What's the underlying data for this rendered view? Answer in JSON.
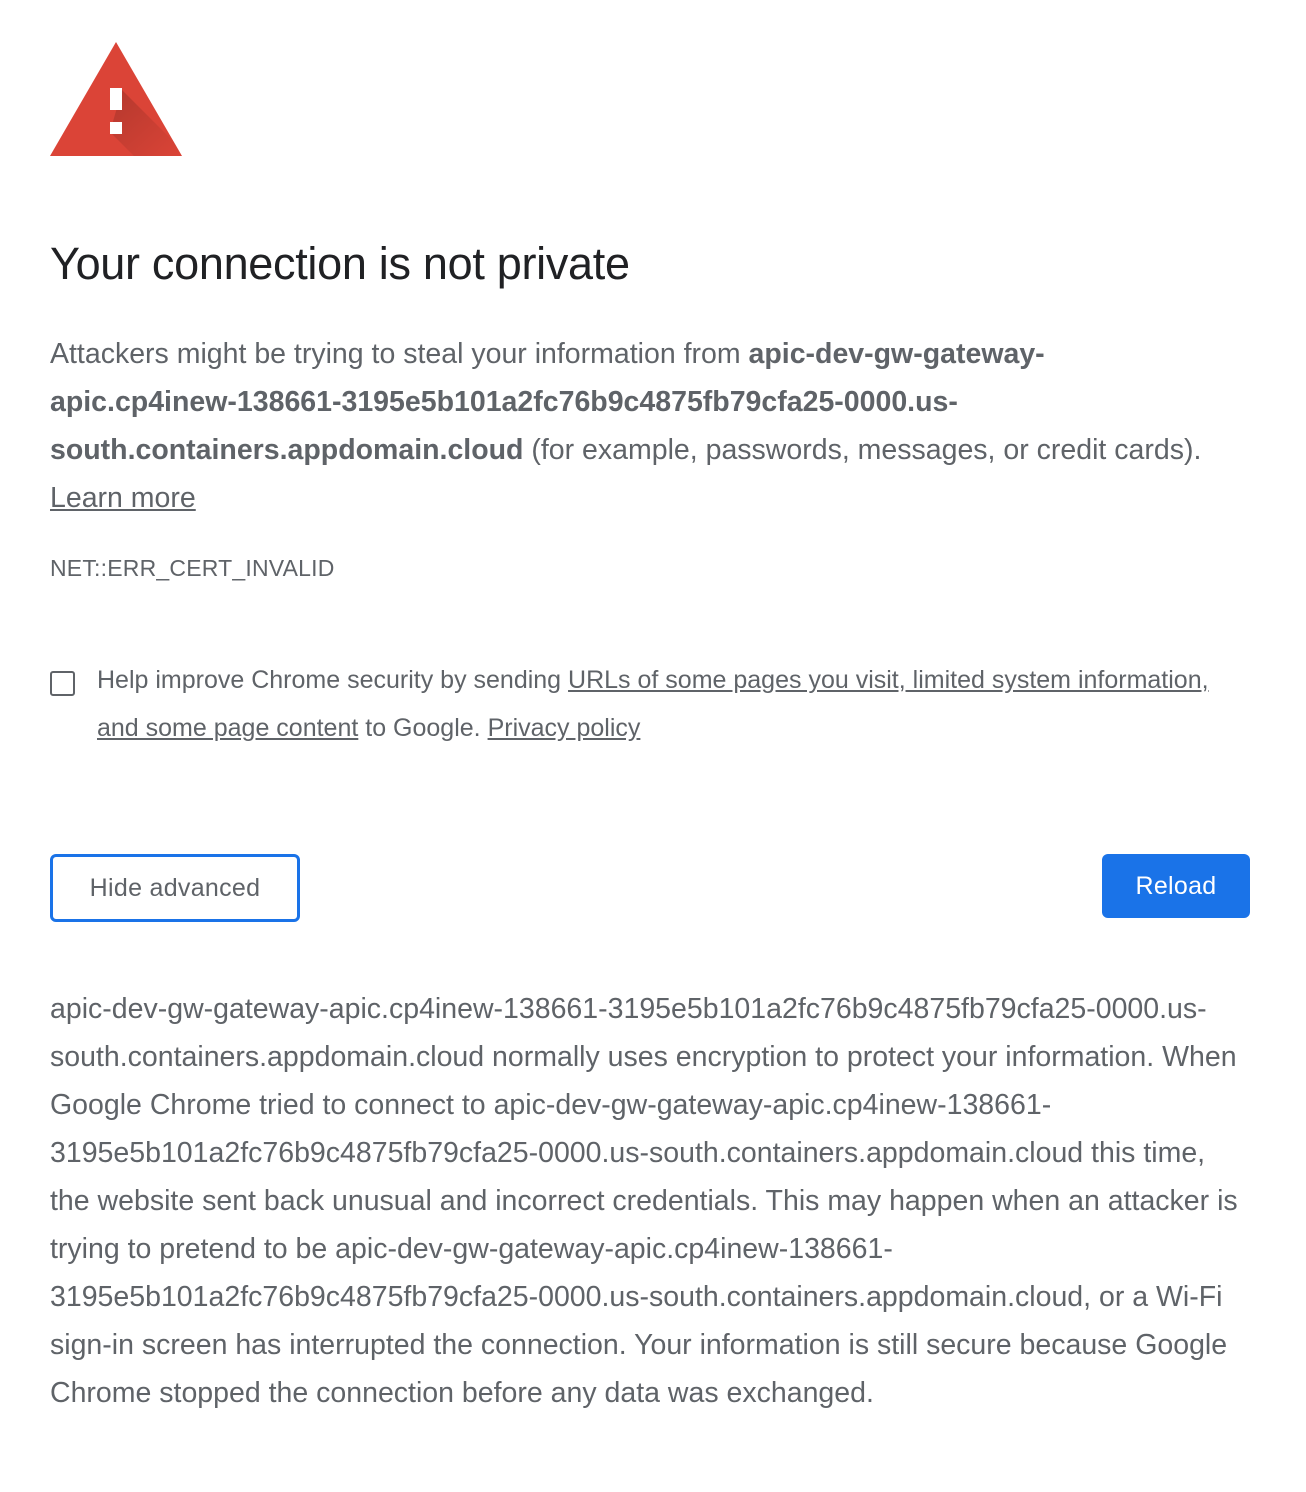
{
  "icon": {
    "name": "warning-icon",
    "color": "#db4437"
  },
  "title": "Your connection is not private",
  "main_message": {
    "prefix": "Attackers might be trying to steal your information from ",
    "host": "apic-dev-gw-gateway-apic.cp4inew-138661-3195e5b101a2fc76b9c4875fb79cfa25-0000.us-south.containers.appdomain.cloud",
    "suffix": " (for example, passwords, messages, or credit cards). ",
    "learn_more": "Learn more"
  },
  "error_code": "NET::ERR_CERT_INVALID",
  "optin": {
    "checked": false,
    "prefix": "Help improve Chrome security by sending ",
    "link": "URLs of some pages you visit, limited system information, and some page content",
    "middle": " to Google. ",
    "privacy": "Privacy policy"
  },
  "buttons": {
    "hide_advanced": "Hide advanced",
    "reload": "Reload"
  },
  "details": "apic-dev-gw-gateway-apic.cp4inew-138661-3195e5b101a2fc76b9c4875fb79cfa25-0000.us-south.containers.appdomain.cloud normally uses encryption to protect your information. When Google Chrome tried to connect to apic-dev-gw-gateway-apic.cp4inew-138661-3195e5b101a2fc76b9c4875fb79cfa25-0000.us-south.containers.appdomain.cloud this time, the website sent back unusual and incorrect credentials. This may happen when an attacker is trying to pretend to be apic-dev-gw-gateway-apic.cp4inew-138661-3195e5b101a2fc76b9c4875fb79cfa25-0000.us-south.containers.appdomain.cloud, or a Wi-Fi sign-in screen has interrupted the connection. Your information is still secure because Google Chrome stopped the connection before any data was exchanged.",
  "colors": {
    "accent": "#1a73e8",
    "title": "#202124",
    "text": "#5f6368",
    "warning": "#db4437"
  }
}
